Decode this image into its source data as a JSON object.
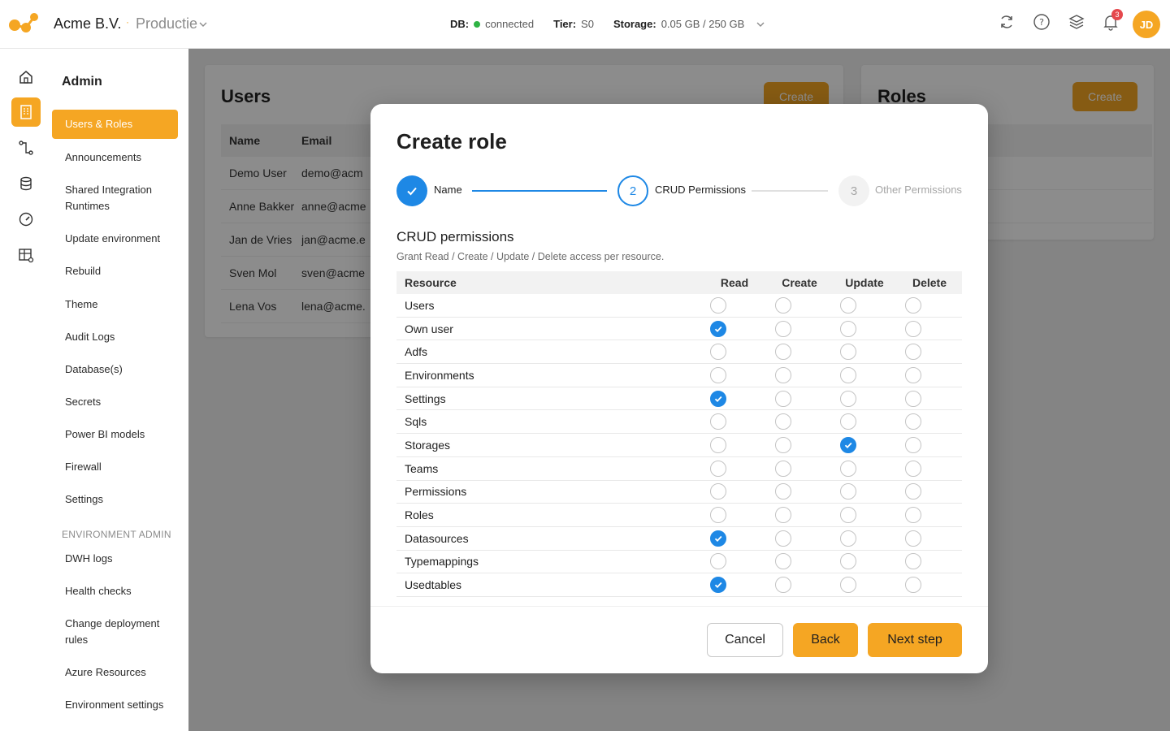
{
  "header": {
    "company": "Acme B.V.",
    "separator": "·",
    "environment": "Productie",
    "db_label": "DB:",
    "db_status": "connected",
    "tier_label": "Tier:",
    "tier_value": "S0",
    "storage_label": "Storage:",
    "storage_value": "0.05 GB / 250 GB",
    "notifications_count": "3",
    "avatar_initials": "JD",
    "colors": {
      "accent": "#f5a623",
      "connected": "#2fb344",
      "badge": "#e5484d"
    }
  },
  "rail": {
    "icons": [
      "home-icon",
      "building-icon",
      "flow-icon",
      "database-icon",
      "gauge-icon",
      "table-settings-icon"
    ],
    "active": "building-icon"
  },
  "sidebar": {
    "title": "Admin",
    "items": [
      {
        "label": "Users & Roles",
        "active": true
      },
      {
        "label": "Announcements"
      },
      {
        "label": "Shared Integration Runtimes"
      },
      {
        "label": "Update environment"
      },
      {
        "label": "Rebuild"
      },
      {
        "label": "Theme"
      },
      {
        "label": "Audit Logs"
      },
      {
        "label": "Database(s)"
      },
      {
        "label": "Secrets"
      },
      {
        "label": "Power BI models"
      },
      {
        "label": "Firewall"
      },
      {
        "label": "Settings"
      }
    ],
    "section": "ENVIRONMENT ADMIN",
    "env_items": [
      {
        "label": "DWH logs"
      },
      {
        "label": "Health checks"
      },
      {
        "label": "Change deployment rules"
      },
      {
        "label": "Azure Resources"
      },
      {
        "label": "Environment settings"
      }
    ]
  },
  "users_card": {
    "title": "Users",
    "create": "Create",
    "columns": [
      "Name",
      "Email"
    ],
    "rows": [
      [
        "Demo User",
        "demo@acm"
      ],
      [
        "Anne Bakker",
        "anne@acme"
      ],
      [
        "Jan de Vries",
        "jan@acme.e"
      ],
      [
        "Sven Mol",
        "sven@acme"
      ],
      [
        "Lena Vos",
        "lena@acme."
      ]
    ]
  },
  "roles_card": {
    "title": "Roles",
    "create": "Create"
  },
  "modal": {
    "title": "Create role",
    "steps": [
      {
        "number": "1",
        "label": "Name",
        "state": "done"
      },
      {
        "number": "2",
        "label": "CRUD Permissions",
        "state": "active"
      },
      {
        "number": "3",
        "label": "Other Permissions",
        "state": "pending"
      }
    ],
    "section_title": "CRUD permissions",
    "section_subtitle": "Grant Read / Create / Update / Delete access per resource.",
    "columns": [
      "Resource",
      "Read",
      "Create",
      "Update",
      "Delete"
    ],
    "rows": [
      {
        "resource": "Users",
        "read": false,
        "create": false,
        "update": false,
        "delete": false
      },
      {
        "resource": "Own user",
        "read": true,
        "create": false,
        "update": false,
        "delete": false
      },
      {
        "resource": "Adfs",
        "read": false,
        "create": false,
        "update": false,
        "delete": false
      },
      {
        "resource": "Environments",
        "read": false,
        "create": false,
        "update": false,
        "delete": false
      },
      {
        "resource": "Settings",
        "read": true,
        "create": false,
        "update": false,
        "delete": false
      },
      {
        "resource": "Sqls",
        "read": false,
        "create": false,
        "update": false,
        "delete": false
      },
      {
        "resource": "Storages",
        "read": false,
        "create": false,
        "update": true,
        "delete": false
      },
      {
        "resource": "Teams",
        "read": false,
        "create": false,
        "update": false,
        "delete": false
      },
      {
        "resource": "Permissions",
        "read": false,
        "create": false,
        "update": false,
        "delete": false
      },
      {
        "resource": "Roles",
        "read": false,
        "create": false,
        "update": false,
        "delete": false
      },
      {
        "resource": "Datasources",
        "read": true,
        "create": false,
        "update": false,
        "delete": false
      },
      {
        "resource": "Typemappings",
        "read": false,
        "create": false,
        "update": false,
        "delete": false
      },
      {
        "resource": "Usedtables",
        "read": true,
        "create": false,
        "update": false,
        "delete": false
      }
    ],
    "buttons": {
      "cancel": "Cancel",
      "back": "Back",
      "next": "Next step"
    },
    "colors": {
      "primary": "#1e88e5",
      "accent": "#f5a623"
    }
  }
}
